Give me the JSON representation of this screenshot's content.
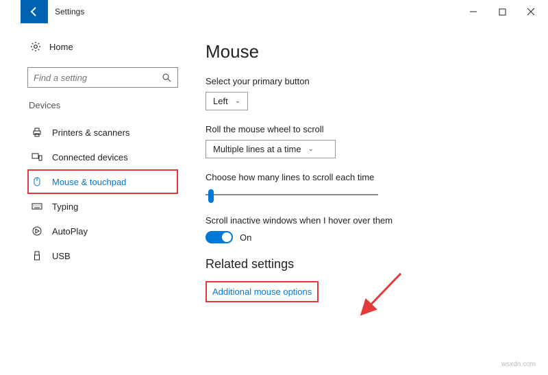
{
  "window": {
    "title": "Settings"
  },
  "sidebar": {
    "home_label": "Home",
    "search_placeholder": "Find a setting",
    "group_label": "Devices",
    "items": [
      {
        "label": "Printers & scanners"
      },
      {
        "label": "Connected devices"
      },
      {
        "label": "Mouse & touchpad"
      },
      {
        "label": "Typing"
      },
      {
        "label": "AutoPlay"
      },
      {
        "label": "USB"
      }
    ]
  },
  "main": {
    "title": "Mouse",
    "primary_button_label": "Select your primary button",
    "primary_button_value": "Left",
    "scroll_label": "Roll the mouse wheel to scroll",
    "scroll_value": "Multiple lines at a time",
    "lines_label": "Choose how many lines to scroll each time",
    "inactive_label": "Scroll inactive windows when I hover over them",
    "inactive_state": "On",
    "related_title": "Related settings",
    "additional_link": "Additional mouse options"
  },
  "watermark": "wsxdn.com"
}
